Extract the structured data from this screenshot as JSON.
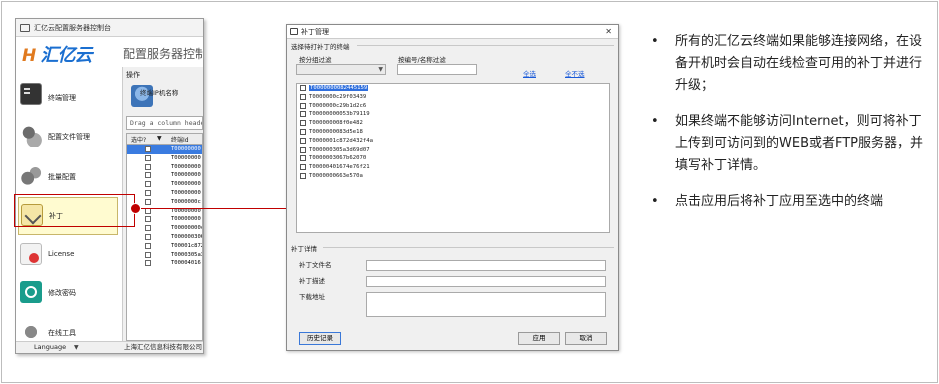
{
  "app": {
    "title": "汇亿云配置服务器控制台",
    "logo_text": "汇亿云",
    "logo_mark": "H",
    "headline": "配置服务器控制",
    "sidebar": [
      {
        "label": "终端管理",
        "icon": "terminal-icon",
        "active": false
      },
      {
        "label": "配置文件管理",
        "icon": "config-file-icon",
        "active": false
      },
      {
        "label": "批量配置",
        "icon": "gears-icon",
        "active": false
      },
      {
        "label": "补丁",
        "icon": "patch-icon",
        "active": true
      },
      {
        "label": "License",
        "icon": "license-icon",
        "active": false
      },
      {
        "label": "修改密码",
        "icon": "key-icon",
        "active": false
      },
      {
        "label": "在线工具",
        "icon": "tools-icon",
        "active": false
      }
    ],
    "ops_label": "操作",
    "toolbar_label": "终端IP机名称",
    "drag_hint": "Drag a column header",
    "grid": {
      "headers": {
        "selected": "选中?",
        "terminal_id": "终端Id"
      },
      "rows": [
        {
          "id": "T00000000",
          "selected": true
        },
        {
          "id": "T00000000",
          "selected": false
        },
        {
          "id": "T00000000",
          "selected": false
        },
        {
          "id": "T00000000",
          "selected": false
        },
        {
          "id": "T00000000",
          "selected": false
        },
        {
          "id": "T00000000",
          "selected": false
        },
        {
          "id": "T0000000c",
          "selected": false
        },
        {
          "id": "T00000000",
          "selected": false
        },
        {
          "id": "T00000000",
          "selected": false
        },
        {
          "id": "T00000000c",
          "selected": false
        },
        {
          "id": "T000000306",
          "selected": false
        },
        {
          "id": "T00001c872",
          "selected": false
        },
        {
          "id": "T0000305a3",
          "selected": false
        },
        {
          "id": "T00004016",
          "selected": false
        }
      ]
    },
    "status": {
      "language": "Language",
      "company": "上海汇亿信息科技有限公司"
    }
  },
  "dialog": {
    "title": "补丁管理",
    "select_section": "选择待打补丁的终端",
    "group_filter_label": "按分组过滤",
    "number_filter_label": "按编号/名称过滤",
    "select_all": "全选",
    "deselect_all": "全不选",
    "terminals": [
      {
        "id": "T0000000082445159",
        "selected": true
      },
      {
        "id": "T0000000c29f03439",
        "selected": false
      },
      {
        "id": "T0000000c29b1d2c6",
        "selected": false
      },
      {
        "id": "T00000000053b79119",
        "selected": false
      },
      {
        "id": "T000000008f0e482",
        "selected": false
      },
      {
        "id": "T0000000083d5e18",
        "selected": false
      },
      {
        "id": "T0000001c872d432f4a",
        "selected": false
      },
      {
        "id": "T000000305a3d69d07",
        "selected": false
      },
      {
        "id": "T0000003067b62070",
        "selected": false
      },
      {
        "id": "T00000401674e76f21",
        "selected": false
      },
      {
        "id": "T0000000663e570a",
        "selected": false
      }
    ],
    "details_section": "补丁详情",
    "file_name_label": "补丁文件名",
    "description_label": "补丁描述",
    "download_label": "下载地址",
    "history_button": "历史记录",
    "apply_button": "应用",
    "cancel_button": "取消"
  },
  "notes": [
    "所有的汇亿云终端如果能够连接网络，在设备开机时会自动在线检查可用的补丁并进行升级；",
    " 如果终端不能够访问Internet，则可将补丁上传到可访问到的WEB或者FTP服务器，并填写补丁详情。",
    "点击应用后将补丁应用至选中的终端"
  ],
  "colors": {
    "accent_red": "#c00000",
    "link_blue": "#1a5ad8",
    "selection_blue": "#2f6fde",
    "logo_blue": "#1b6fd0",
    "logo_orange": "#e07a1f"
  }
}
